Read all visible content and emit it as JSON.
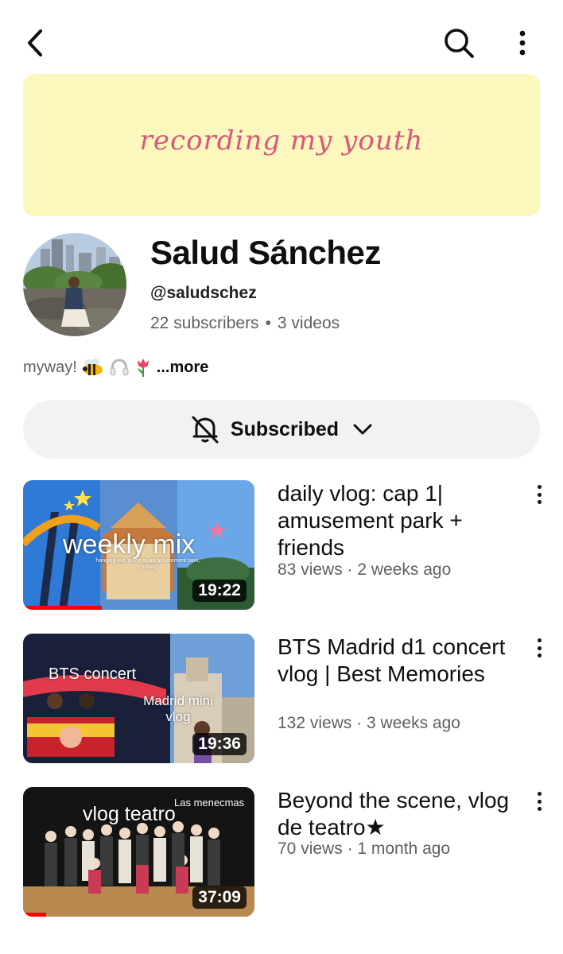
{
  "header": {
    "back_icon": "arrow-back-icon",
    "search_icon": "search-icon",
    "more_icon": "more-vert-icon"
  },
  "banner": {
    "text": "recording my youth",
    "background": "#fbf7bd",
    "text_color": "#d9577a"
  },
  "channel": {
    "name": "Salud Sánchez",
    "handle": "@saludschez",
    "subscribers": "22 subscribers",
    "videos": "3 videos",
    "separator": "•",
    "bio": "myway!",
    "bio_icons": [
      "bee-emoji",
      "headphones-emoji",
      "tulip-emoji"
    ],
    "more_label": "...more"
  },
  "subscribe": {
    "label": "Subscribed",
    "bell_icon": "bell-off-icon",
    "chevron_icon": "chevron-down-icon"
  },
  "videos": [
    {
      "title": "daily vlog: cap 1| amusement park + friends",
      "views": "83 views",
      "age": "2 weeks ago",
      "meta": "83 views · 2 weeks ago",
      "duration": "19:22",
      "thumb_title": "weekly mix",
      "thumb_caption": "hanging out, going to an amusement park, cooking",
      "watched_fraction": 0.34
    },
    {
      "title": "BTS Madrid d1 concert vlog | Best Memories",
      "views": "132 views",
      "age": "3 weeks ago",
      "meta": "132 views · 3 weeks ago",
      "duration": "19:36",
      "thumb_title": "BTS concert",
      "thumb_subtitle": "Madrid mini vlog",
      "watched_fraction": 0.0
    },
    {
      "title": "Beyond the scene, vlog de teatro★",
      "views": "70 views",
      "age": "1 month ago",
      "meta": "70 views · 1 month ago",
      "duration": "37:09",
      "thumb_title": "vlog teatro",
      "thumb_corner": "Las menecmas",
      "watched_fraction": 0.1
    }
  ]
}
